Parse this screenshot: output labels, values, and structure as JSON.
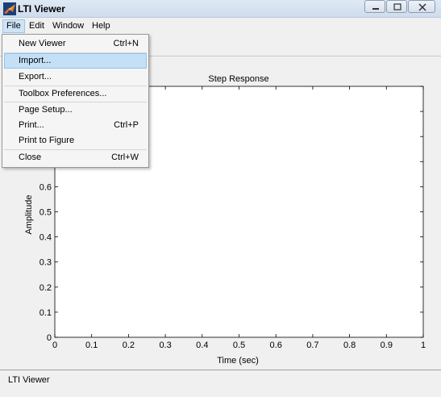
{
  "window": {
    "title": "LTI Viewer"
  },
  "menubar": {
    "items": [
      "File",
      "Edit",
      "Window",
      "Help"
    ]
  },
  "file_menu": {
    "items": [
      {
        "label": "New Viewer",
        "shortcut": "Ctrl+N"
      },
      {
        "label": "Import...",
        "shortcut": ""
      },
      {
        "label": "Export...",
        "shortcut": ""
      },
      {
        "label": "Toolbox Preferences...",
        "shortcut": ""
      },
      {
        "label": "Page Setup...",
        "shortcut": ""
      },
      {
        "label": "Print...",
        "shortcut": "Ctrl+P"
      },
      {
        "label": "Print to Figure",
        "shortcut": ""
      },
      {
        "label": "Close",
        "shortcut": "Ctrl+W"
      }
    ],
    "highlighted": "Import..."
  },
  "status": {
    "text": "LTI Viewer"
  },
  "chart_data": {
    "type": "line",
    "title": "Step Response",
    "xlabel": "Time (sec)",
    "ylabel": "Amplitude",
    "xlim": [
      0,
      1
    ],
    "ylim": [
      0,
      1
    ],
    "xticks": [
      "0",
      "0.1",
      "0.2",
      "0.3",
      "0.4",
      "0.5",
      "0.6",
      "0.7",
      "0.8",
      "0.9",
      "1"
    ],
    "yticks": [
      "0",
      "0.1",
      "0.2",
      "0.3",
      "0.4",
      "0.5",
      "0.6"
    ],
    "series": [],
    "grid": false
  },
  "colors": {
    "menu_highlight": "#c3e0f7",
    "axes_background": "#ffffff",
    "figure_background": "#f0f0f0"
  }
}
